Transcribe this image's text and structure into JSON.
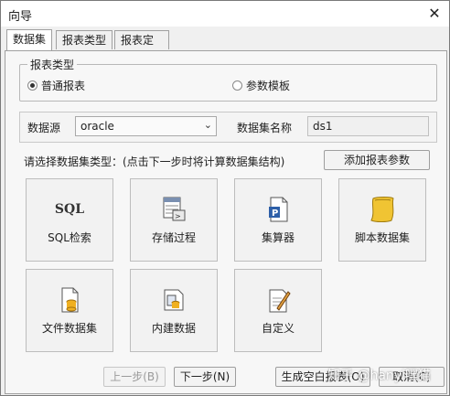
{
  "window": {
    "title": "向导"
  },
  "tabs": [
    {
      "label": "数据集"
    },
    {
      "label": "报表类型"
    },
    {
      "label": "报表定义"
    }
  ],
  "report_type": {
    "legend": "报表类型",
    "option_normal": "普通报表",
    "option_param": "参数模板",
    "selected": "普通报表"
  },
  "datasource": {
    "label": "数据源",
    "value": "oracle",
    "dataset_name_label": "数据集名称",
    "dataset_name_value": "ds1"
  },
  "dataset_type": {
    "hint": "请选择数据集类型：(点击下一步时将计算数据集结构)",
    "add_params_label": "添加报表参数",
    "tiles": [
      {
        "label": "SQL检索",
        "icon": "sql-icon",
        "icon_text": "SQL"
      },
      {
        "label": "存储过程",
        "icon": "stored-procedure-icon"
      },
      {
        "label": "集算器",
        "icon": "calculator-doc-icon"
      },
      {
        "label": "脚本数据集",
        "icon": "script-scroll-icon"
      },
      {
        "label": "文件数据集",
        "icon": "file-db-icon"
      },
      {
        "label": "内建数据",
        "icon": "builtin-data-icon"
      },
      {
        "label": "自定义",
        "icon": "custom-edit-icon"
      }
    ]
  },
  "footer": {
    "prev_label": "上一步(B)",
    "next_label": "下一步(N)",
    "gen_empty_label": "生成空白报表(O)",
    "cancel_label": "取消(C)"
  },
  "watermark": "知乎 @hanyi嘿猫"
}
